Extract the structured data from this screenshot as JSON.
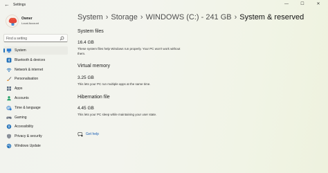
{
  "window": {
    "title": "Settings",
    "minimize_glyph": "—",
    "maximize_glyph": "☐",
    "close_glyph": "✕",
    "back_glyph": "←"
  },
  "user": {
    "name": "Owner",
    "account_type": "Local Account"
  },
  "search": {
    "placeholder": "Find a setting",
    "value": ""
  },
  "sidebar": {
    "items": [
      {
        "label": "System",
        "icon": "monitor-icon",
        "selected": true
      },
      {
        "label": "Bluetooth & devices",
        "icon": "bluetooth-icon",
        "selected": false
      },
      {
        "label": "Network & internet",
        "icon": "wifi-icon",
        "selected": false
      },
      {
        "label": "Personalisation",
        "icon": "brush-icon",
        "selected": false
      },
      {
        "label": "Apps",
        "icon": "apps-icon",
        "selected": false
      },
      {
        "label": "Accounts",
        "icon": "person-icon",
        "selected": false
      },
      {
        "label": "Time & language",
        "icon": "globe-clock-icon",
        "selected": false
      },
      {
        "label": "Gaming",
        "icon": "gamepad-icon",
        "selected": false
      },
      {
        "label": "Accessibility",
        "icon": "accessibility-icon",
        "selected": false
      },
      {
        "label": "Privacy & security",
        "icon": "shield-icon",
        "selected": false
      },
      {
        "label": "Windows Update",
        "icon": "update-icon",
        "selected": false
      }
    ]
  },
  "breadcrumb": {
    "parts": [
      "System",
      "Storage",
      "WINDOWS (C:) - 241 GB"
    ],
    "current": "System & reserved",
    "separator": "›"
  },
  "sections": [
    {
      "title": "System files",
      "size": "16.4 GB",
      "description": "These system files help Windows run properly. Your PC won't work without them."
    },
    {
      "title": "Virtual memory",
      "size": "3.25 GB",
      "description": "This lets your PC run multiple apps at the same time."
    },
    {
      "title": "Hibernation file",
      "size": "4.45 GB",
      "description": "This lets your PC sleep while maintaining your user state."
    }
  ],
  "help": {
    "label": "Get help"
  },
  "colors": {
    "accent": "#1f6fb8",
    "link": "#1a5fb4",
    "selected_bg": "#eaebe5"
  }
}
